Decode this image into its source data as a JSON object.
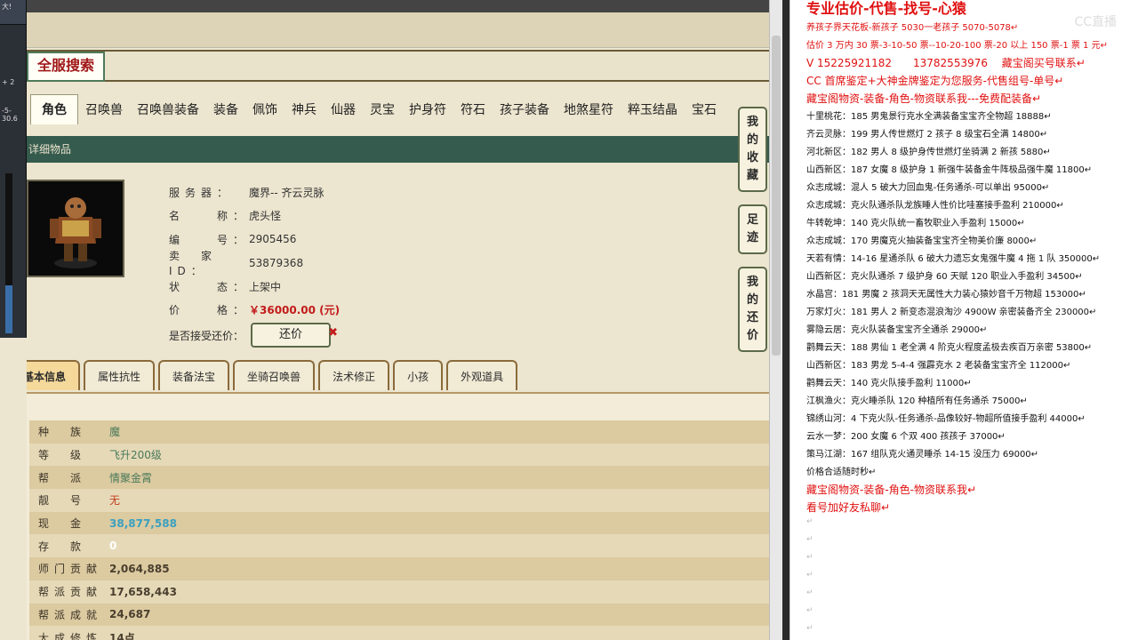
{
  "left_strip": {
    "top_label": "大!",
    "rows": [
      "+ 2",
      "-5-30.6"
    ]
  },
  "game": {
    "search_badge": "全服搜索",
    "main_tabs": [
      "角色",
      "召唤兽",
      "召唤兽装备",
      "装备",
      "佩饰",
      "神兵",
      "仙器",
      "灵宝",
      "护身符",
      "符石",
      "孩子装备",
      "地煞星符",
      "粹玉结晶",
      "宝石"
    ],
    "section_title": "详细物品",
    "info": [
      {
        "label": "服务器：",
        "value": "魔界-- 齐云灵脉"
      },
      {
        "label": "名　　称：",
        "value": "虎头怪"
      },
      {
        "label": "编　　号：",
        "value": "2905456"
      },
      {
        "label": "卖　家 ID：",
        "value": "53879368"
      },
      {
        "label": "状　　态：",
        "value": "上架中"
      }
    ],
    "price_label": "价　　格：",
    "price_value": "￥36000.00 (元)",
    "counter_label": "是否接受还价：",
    "counter_button": "还价",
    "sub_tabs": [
      "基本信息",
      "属性抗性",
      "装备法宝",
      "坐骑召唤兽",
      "法术修正",
      "小孩",
      "外观道具"
    ],
    "attributes": [
      {
        "k": "种　族",
        "v": "魔",
        "style": "v"
      },
      {
        "k": "等　级",
        "v": "飞升200级",
        "style": "v"
      },
      {
        "k": "帮　派",
        "v": "情聚金霄",
        "style": "v"
      },
      {
        "k": "靓　号",
        "v": "无",
        "style": "v red"
      },
      {
        "k": "现　金",
        "v": "38,877,588",
        "style": "v cyan"
      },
      {
        "k": "存　款",
        "v": "0",
        "style": "v white"
      },
      {
        "k": "师门贡献",
        "v": "2,064,885",
        "style": "v bold"
      },
      {
        "k": "帮派贡献",
        "v": "17,658,443",
        "style": "v bold"
      },
      {
        "k": "帮派成就",
        "v": "24,687",
        "style": "v bold"
      },
      {
        "k": "大成修炼",
        "v": "14点",
        "style": "v bold"
      }
    ],
    "side_nav": [
      "我的收藏",
      "足迹",
      "我的还价"
    ]
  },
  "doc": {
    "watermark": "CC直播",
    "lines": [
      {
        "t": "专业估价-代售-找号-心猿",
        "c": "red big"
      },
      {
        "t": "养孩子界天花板-新孩子 5030一老孩子 5070-5078↵",
        "c": "red"
      },
      {
        "t": "估价 3 万内 30 票-3-10-50 票--10-20-100 票-20 以上 150 票-1 票 1 元↵",
        "c": "red"
      },
      {
        "t": "V 15225921182　　13782553976　 藏宝阁买号联系↵",
        "c": "red mid"
      },
      {
        "t": "CC 首席鉴定+大神金牌鉴定为您服务-代售组号-单号↵",
        "c": "red mid"
      },
      {
        "t": "藏宝阁物资-装备-角色-物资联系我---免费配装备↵",
        "c": "red mid"
      },
      {
        "t": "十里桃花：185 男鬼景行克水全满装备宝宝齐全物超 18888↵",
        "c": ""
      },
      {
        "t": "齐云灵脉：199 男人传世燃灯 2 孩子 8 级宝石全满 14800↵",
        "c": ""
      },
      {
        "t": "河北新区：182 男人 8 级护身传世燃灯坐骑满 2 新孩 5880↵",
        "c": ""
      },
      {
        "t": "山西新区：187 女魔 8 级护身 1 新强牛装备金牛阵极品强牛魔 11800↵",
        "c": ""
      },
      {
        "t": "众志成城：混人 5 破大力回血鬼-任务通杀-可以单出 95000↵",
        "c": ""
      },
      {
        "t": "众志成城：克火队通杀队龙族睡人性价比哇塞接手盈利 210000↵",
        "c": ""
      },
      {
        "t": "牛转乾坤：140 克火队统一畜牧职业入手盈利 15000↵",
        "c": ""
      },
      {
        "t": "众志成城：170 男魔克火抽装备宝宝齐全物美价廉 8000↵",
        "c": ""
      },
      {
        "t": "天若有情：14-16 星通杀队 6 破大力遗忘女鬼强牛魔 4 拖 1 队 350000↵",
        "c": ""
      },
      {
        "t": "山西新区：克火队通杀 7 级护身 60 天赋 120 职业入手盈利 34500↵",
        "c": ""
      },
      {
        "t": "水晶宫：181 男魔 2 孩洞天无属性大力装心猿妙音千万物超 153000↵",
        "c": ""
      },
      {
        "t": "万家灯火：181 男人 2 新变态混浪淘沙 4900W 亲密装备齐全 230000↵",
        "c": ""
      },
      {
        "t": "雾隐云居：克火队装备宝宝齐全通杀 29000↵",
        "c": ""
      },
      {
        "t": "鹳舞云天：188 男仙 1 老全满 4 阶克火程度孟极去疾百万亲密 53800↵",
        "c": ""
      },
      {
        "t": "山西新区：183 男龙 5-4-4 强霹克水 2 老装备宝宝齐全 112000↵",
        "c": ""
      },
      {
        "t": "鹳舞云天：140 克火队接手盈利 11000↵",
        "c": ""
      },
      {
        "t": "江枫渔火：克火睡杀队 120 种植所有任务通杀 75000↵",
        "c": ""
      },
      {
        "t": "锦绣山河：4 下克火队-任务通杀-品像较好-物超所值接手盈利 44000↵",
        "c": ""
      },
      {
        "t": "云水一梦：200 女魔 6 个双 400 孩孩子 37000↵",
        "c": ""
      },
      {
        "t": "策马江湖：167 组队克火通灵睡杀 14-15 没压力 69000↵",
        "c": ""
      },
      {
        "t": "价格合适随时秒↵",
        "c": ""
      },
      {
        "t": "藏宝阁物资-装备-角色-物资联系我↵",
        "c": "red mid"
      },
      {
        "t": "看号加好友私聊↵",
        "c": "red mid"
      },
      {
        "t": "↵",
        "c": "pm"
      },
      {
        "t": "↵",
        "c": "pm"
      },
      {
        "t": "↵",
        "c": "pm"
      },
      {
        "t": "↵",
        "c": "pm"
      },
      {
        "t": "↵",
        "c": "pm"
      },
      {
        "t": "↵",
        "c": "pm"
      },
      {
        "t": "↵",
        "c": "pm"
      }
    ]
  }
}
